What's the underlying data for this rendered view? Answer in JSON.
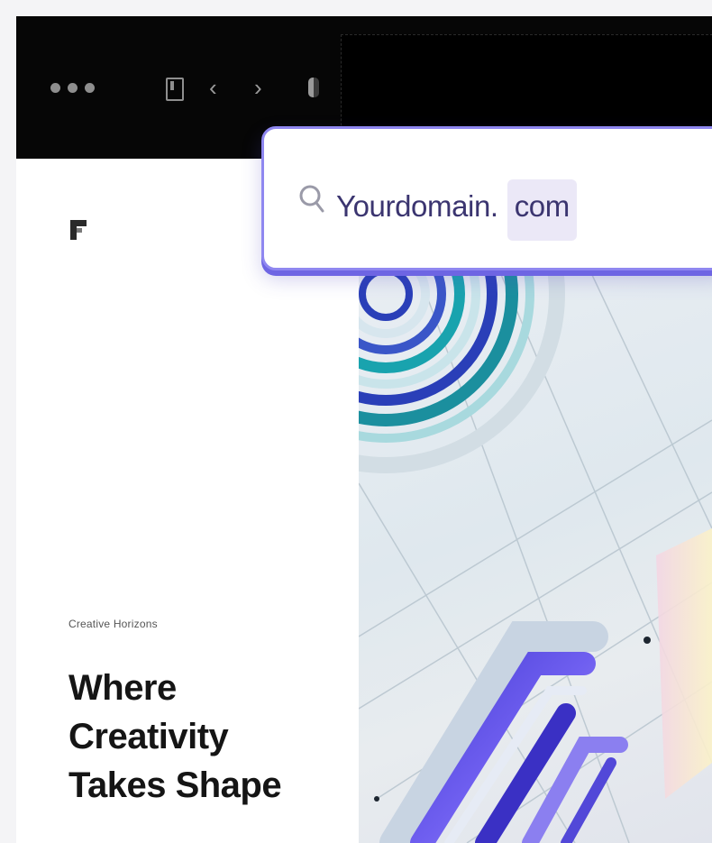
{
  "browser": {
    "address_bar": {
      "domain": "Yourdomain.",
      "tld": "com"
    },
    "controls": {
      "back_glyph": "‹",
      "forward_glyph": "›"
    },
    "icons": [
      "window-dots-icon",
      "sidebar-toggle-icon",
      "back-arrow-icon",
      "forward-arrow-icon",
      "shield-icon",
      "search-icon"
    ]
  },
  "page": {
    "eyebrow": "Creative Horizons",
    "headline_line1": "Where Creativity",
    "headline_line2": "Takes Shape"
  },
  "colors": {
    "accent": "#8f87f0",
    "accent_dark": "#6e65e3",
    "chrome": "#060606",
    "text": "#151515"
  }
}
